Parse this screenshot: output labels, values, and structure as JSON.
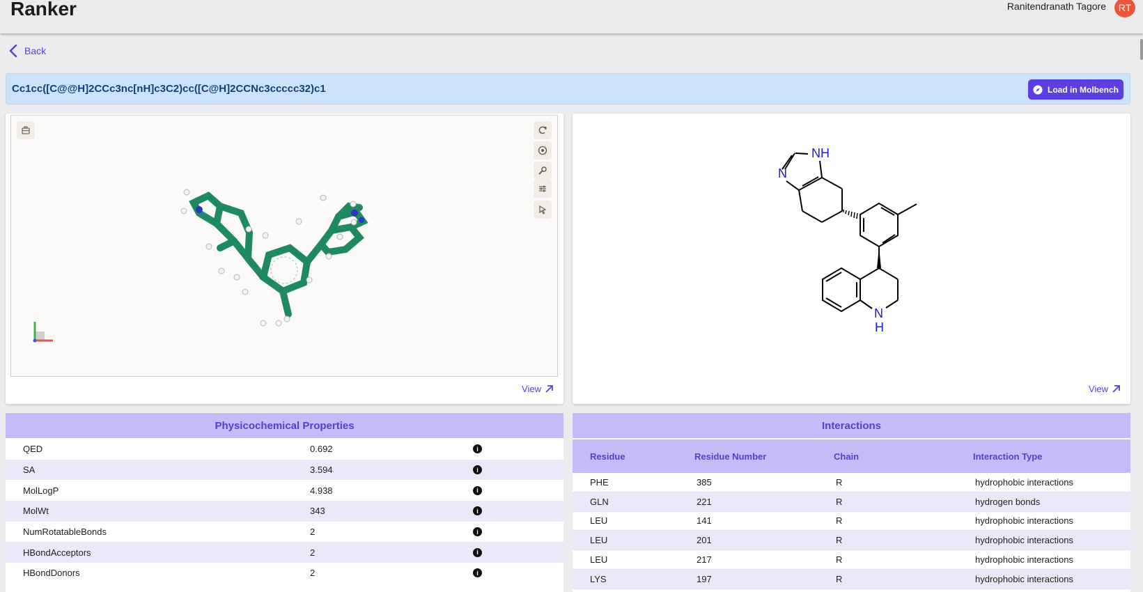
{
  "header": {
    "brand": "Ranker",
    "user_name": "Ranitendranath Tagore",
    "avatar_initials": "RT"
  },
  "nav": {
    "back_label": "Back"
  },
  "molecule": {
    "smiles": "Cc1cc([C@@H]2CCc3nc[nH]c3C2)cc([C@H]2CCNc3ccccc32)c1",
    "load_button": "Load in Molbench"
  },
  "viewer3d": {
    "view_label": "View"
  },
  "structure2d": {
    "view_label": "View",
    "atom_labels": {
      "nh_top": "NH",
      "n_left": "N",
      "nh_bottom_n": "N",
      "nh_bottom_h": "H"
    }
  },
  "physchem": {
    "title": "Physicochemical Properties",
    "rows": [
      {
        "name": "QED",
        "value": "0.692"
      },
      {
        "name": "SA",
        "value": "3.594"
      },
      {
        "name": "MolLogP",
        "value": "4.938"
      },
      {
        "name": "MolWt",
        "value": "343"
      },
      {
        "name": "NumRotatableBonds",
        "value": "2"
      },
      {
        "name": "HBondAcceptors",
        "value": "2"
      },
      {
        "name": "HBondDonors",
        "value": "2"
      }
    ]
  },
  "interactions": {
    "title": "Interactions",
    "columns": [
      "Residue",
      "Residue Number",
      "Chain",
      "Interaction Type"
    ],
    "rows": [
      {
        "residue": "PHE",
        "number": "385",
        "chain": "R",
        "type": "hydrophobic interactions"
      },
      {
        "residue": "GLN",
        "number": "221",
        "chain": "R",
        "type": "hydrogen bonds"
      },
      {
        "residue": "LEU",
        "number": "141",
        "chain": "R",
        "type": "hydrophobic interactions"
      },
      {
        "residue": "LEU",
        "number": "201",
        "chain": "R",
        "type": "hydrophobic interactions"
      },
      {
        "residue": "LEU",
        "number": "217",
        "chain": "R",
        "type": "hydrophobic interactions"
      },
      {
        "residue": "LYS",
        "number": "197",
        "chain": "R",
        "type": "hydrophobic interactions"
      }
    ]
  },
  "colors": {
    "accent": "#5b3fe0",
    "panel_header": "#c4bcf8",
    "smiles_bg": "#cce2fb",
    "avatar": "#e8563b",
    "carbon": "#1f8a62",
    "nitrogen": "#2b35c9"
  }
}
